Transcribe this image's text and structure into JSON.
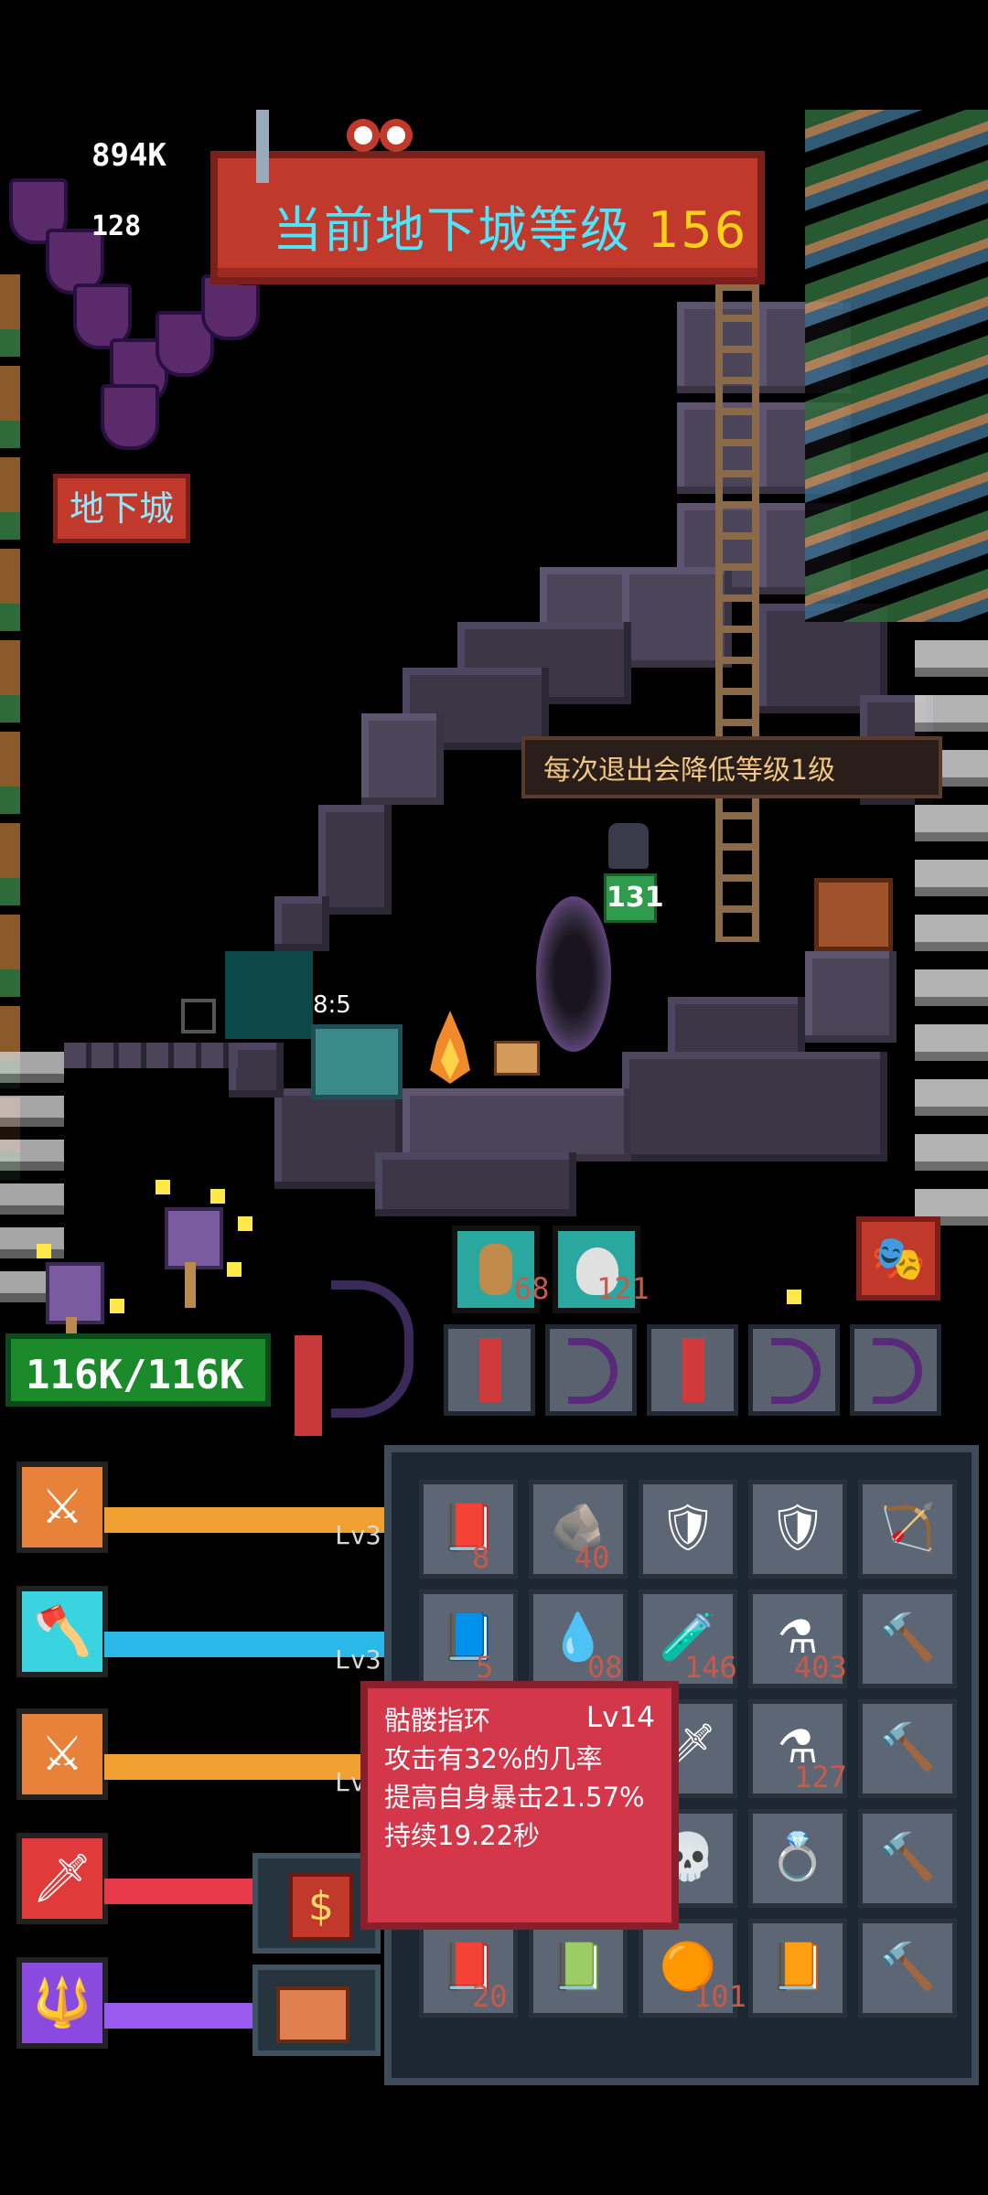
{
  "hud": {
    "gold": "894K",
    "gems": "128",
    "dungeon_button": "地下城"
  },
  "banner": {
    "title": "当前地下城等级",
    "level": "156"
  },
  "scene": {
    "exit_notice": "每次退出会降低等级1级",
    "pet_level": "131",
    "timer": "8:5"
  },
  "player": {
    "hp": "116K/116K"
  },
  "consumable_counts": [
    "68",
    "121"
  ],
  "skills": [
    {
      "icon": "crossed-swords-icon",
      "color": "#e8823a",
      "bar": "#f0a030",
      "lv": "Lv3"
    },
    {
      "icon": "axe-icon",
      "color": "#3ad4e0",
      "bar": "#2ab8e8",
      "lv": "Lv3"
    },
    {
      "icon": "crossed-swords-icon",
      "color": "#e8823a",
      "bar": "#f0a030",
      "lv": "Lv"
    },
    {
      "icon": "fire-sword-icon",
      "color": "#e03a3a",
      "bar": "#e83a4a",
      "lv": ""
    },
    {
      "icon": "trident-icon",
      "color": "#8a4ae0",
      "bar": "#9a5af0",
      "lv": ""
    }
  ],
  "inventory_counts": {
    "r1c1": "8",
    "r1c2": "40",
    "r2c1": "5",
    "r2c2": "08",
    "r2c3": "146",
    "r2c4": "403",
    "r3c4": "127",
    "r5c1": "20",
    "r5c3": "101"
  },
  "item_tooltip": {
    "name": "骷髅指环",
    "level": "Lv14",
    "line1": "攻击有32%的几率",
    "line2": "提高自身暴击21.57%",
    "line3": "持续19.22秒"
  },
  "shop_symbol": "$",
  "colors": {
    "banner_red": "#c0392b",
    "title_cyan": "#4ce6ff",
    "level_yellow": "#ffd21a",
    "hp_green": "#1a8a2a",
    "tooltip_red": "#d4374a"
  }
}
